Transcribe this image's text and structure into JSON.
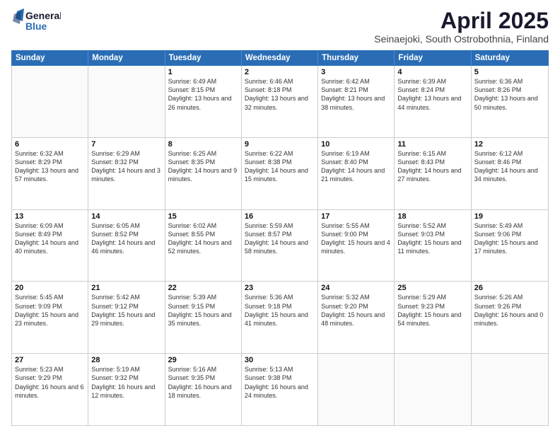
{
  "logo": {
    "general": "General",
    "blue": "Blue"
  },
  "title": "April 2025",
  "subtitle": "Seinaejoki, South Ostrobothnia, Finland",
  "days": [
    "Sunday",
    "Monday",
    "Tuesday",
    "Wednesday",
    "Thursday",
    "Friday",
    "Saturday"
  ],
  "weeks": [
    [
      {
        "day": "",
        "sunrise": "",
        "sunset": "",
        "daylight": ""
      },
      {
        "day": "",
        "sunrise": "",
        "sunset": "",
        "daylight": ""
      },
      {
        "day": "1",
        "sunrise": "Sunrise: 6:49 AM",
        "sunset": "Sunset: 8:15 PM",
        "daylight": "Daylight: 13 hours and 26 minutes."
      },
      {
        "day": "2",
        "sunrise": "Sunrise: 6:46 AM",
        "sunset": "Sunset: 8:18 PM",
        "daylight": "Daylight: 13 hours and 32 minutes."
      },
      {
        "day": "3",
        "sunrise": "Sunrise: 6:42 AM",
        "sunset": "Sunset: 8:21 PM",
        "daylight": "Daylight: 13 hours and 38 minutes."
      },
      {
        "day": "4",
        "sunrise": "Sunrise: 6:39 AM",
        "sunset": "Sunset: 8:24 PM",
        "daylight": "Daylight: 13 hours and 44 minutes."
      },
      {
        "day": "5",
        "sunrise": "Sunrise: 6:36 AM",
        "sunset": "Sunset: 8:26 PM",
        "daylight": "Daylight: 13 hours and 50 minutes."
      }
    ],
    [
      {
        "day": "6",
        "sunrise": "Sunrise: 6:32 AM",
        "sunset": "Sunset: 8:29 PM",
        "daylight": "Daylight: 13 hours and 57 minutes."
      },
      {
        "day": "7",
        "sunrise": "Sunrise: 6:29 AM",
        "sunset": "Sunset: 8:32 PM",
        "daylight": "Daylight: 14 hours and 3 minutes."
      },
      {
        "day": "8",
        "sunrise": "Sunrise: 6:25 AM",
        "sunset": "Sunset: 8:35 PM",
        "daylight": "Daylight: 14 hours and 9 minutes."
      },
      {
        "day": "9",
        "sunrise": "Sunrise: 6:22 AM",
        "sunset": "Sunset: 8:38 PM",
        "daylight": "Daylight: 14 hours and 15 minutes."
      },
      {
        "day": "10",
        "sunrise": "Sunrise: 6:19 AM",
        "sunset": "Sunset: 8:40 PM",
        "daylight": "Daylight: 14 hours and 21 minutes."
      },
      {
        "day": "11",
        "sunrise": "Sunrise: 6:15 AM",
        "sunset": "Sunset: 8:43 PM",
        "daylight": "Daylight: 14 hours and 27 minutes."
      },
      {
        "day": "12",
        "sunrise": "Sunrise: 6:12 AM",
        "sunset": "Sunset: 8:46 PM",
        "daylight": "Daylight: 14 hours and 34 minutes."
      }
    ],
    [
      {
        "day": "13",
        "sunrise": "Sunrise: 6:09 AM",
        "sunset": "Sunset: 8:49 PM",
        "daylight": "Daylight: 14 hours and 40 minutes."
      },
      {
        "day": "14",
        "sunrise": "Sunrise: 6:05 AM",
        "sunset": "Sunset: 8:52 PM",
        "daylight": "Daylight: 14 hours and 46 minutes."
      },
      {
        "day": "15",
        "sunrise": "Sunrise: 6:02 AM",
        "sunset": "Sunset: 8:55 PM",
        "daylight": "Daylight: 14 hours and 52 minutes."
      },
      {
        "day": "16",
        "sunrise": "Sunrise: 5:59 AM",
        "sunset": "Sunset: 8:57 PM",
        "daylight": "Daylight: 14 hours and 58 minutes."
      },
      {
        "day": "17",
        "sunrise": "Sunrise: 5:55 AM",
        "sunset": "Sunset: 9:00 PM",
        "daylight": "Daylight: 15 hours and 4 minutes."
      },
      {
        "day": "18",
        "sunrise": "Sunrise: 5:52 AM",
        "sunset": "Sunset: 9:03 PM",
        "daylight": "Daylight: 15 hours and 11 minutes."
      },
      {
        "day": "19",
        "sunrise": "Sunrise: 5:49 AM",
        "sunset": "Sunset: 9:06 PM",
        "daylight": "Daylight: 15 hours and 17 minutes."
      }
    ],
    [
      {
        "day": "20",
        "sunrise": "Sunrise: 5:45 AM",
        "sunset": "Sunset: 9:09 PM",
        "daylight": "Daylight: 15 hours and 23 minutes."
      },
      {
        "day": "21",
        "sunrise": "Sunrise: 5:42 AM",
        "sunset": "Sunset: 9:12 PM",
        "daylight": "Daylight: 15 hours and 29 minutes."
      },
      {
        "day": "22",
        "sunrise": "Sunrise: 5:39 AM",
        "sunset": "Sunset: 9:15 PM",
        "daylight": "Daylight: 15 hours and 35 minutes."
      },
      {
        "day": "23",
        "sunrise": "Sunrise: 5:36 AM",
        "sunset": "Sunset: 9:18 PM",
        "daylight": "Daylight: 15 hours and 41 minutes."
      },
      {
        "day": "24",
        "sunrise": "Sunrise: 5:32 AM",
        "sunset": "Sunset: 9:20 PM",
        "daylight": "Daylight: 15 hours and 48 minutes."
      },
      {
        "day": "25",
        "sunrise": "Sunrise: 5:29 AM",
        "sunset": "Sunset: 9:23 PM",
        "daylight": "Daylight: 15 hours and 54 minutes."
      },
      {
        "day": "26",
        "sunrise": "Sunrise: 5:26 AM",
        "sunset": "Sunset: 9:26 PM",
        "daylight": "Daylight: 16 hours and 0 minutes."
      }
    ],
    [
      {
        "day": "27",
        "sunrise": "Sunrise: 5:23 AM",
        "sunset": "Sunset: 9:29 PM",
        "daylight": "Daylight: 16 hours and 6 minutes."
      },
      {
        "day": "28",
        "sunrise": "Sunrise: 5:19 AM",
        "sunset": "Sunset: 9:32 PM",
        "daylight": "Daylight: 16 hours and 12 minutes."
      },
      {
        "day": "29",
        "sunrise": "Sunrise: 5:16 AM",
        "sunset": "Sunset: 9:35 PM",
        "daylight": "Daylight: 16 hours and 18 minutes."
      },
      {
        "day": "30",
        "sunrise": "Sunrise: 5:13 AM",
        "sunset": "Sunset: 9:38 PM",
        "daylight": "Daylight: 16 hours and 24 minutes."
      },
      {
        "day": "",
        "sunrise": "",
        "sunset": "",
        "daylight": ""
      },
      {
        "day": "",
        "sunrise": "",
        "sunset": "",
        "daylight": ""
      },
      {
        "day": "",
        "sunrise": "",
        "sunset": "",
        "daylight": ""
      }
    ]
  ]
}
